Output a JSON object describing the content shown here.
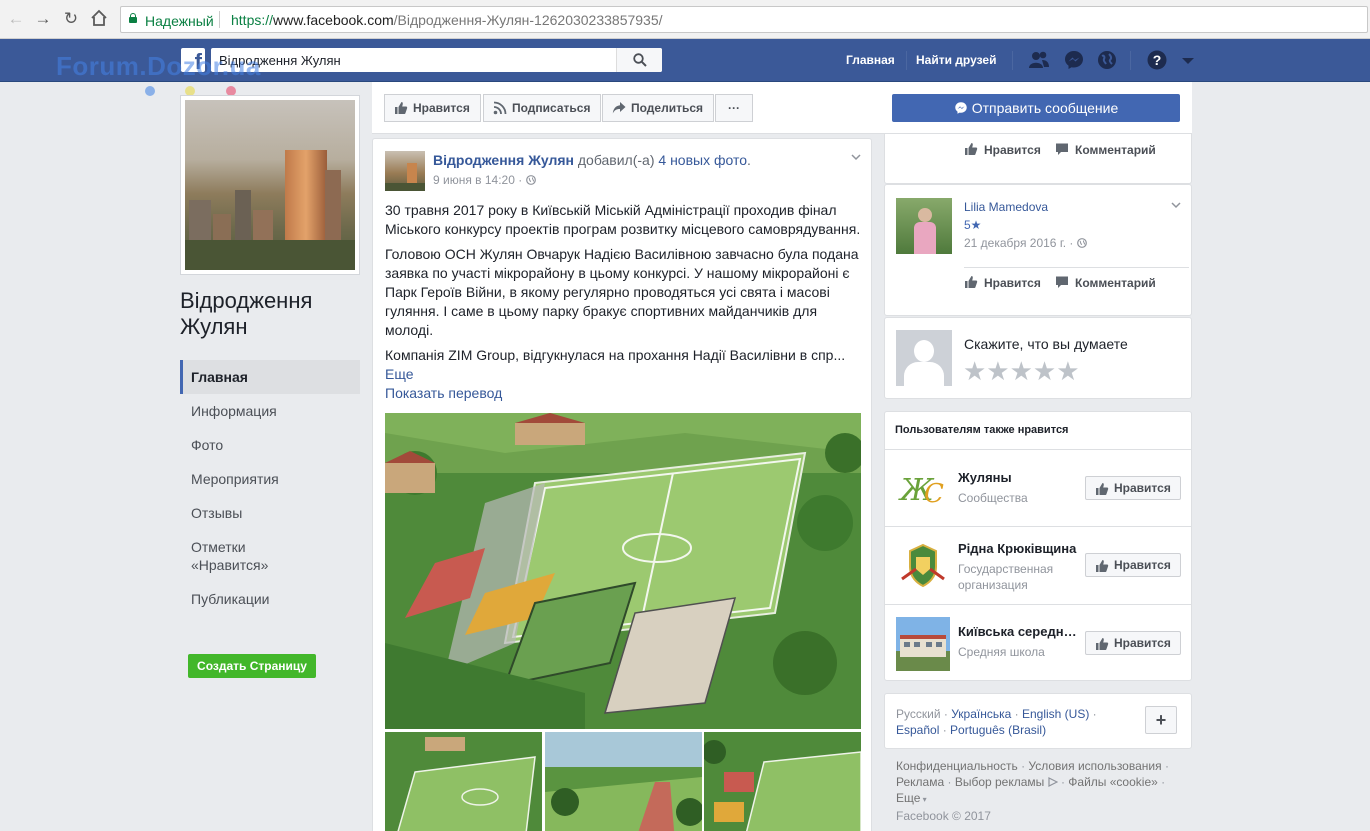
{
  "browser": {
    "secure_label": "Надежный",
    "url_scheme": "https://",
    "url_host": "www.facebook.com",
    "url_path": "/Відродження-Жулян-1262030233857935/"
  },
  "watermark": "Forum.Dozor.ua",
  "topbar": {
    "search_value": "Відродження Жулян",
    "home_label": "Главная",
    "find_friends_label": "Найти друзей",
    "brand_color": "#3b5998"
  },
  "page": {
    "name": "Відродження Жулян",
    "nav": [
      {
        "label": "Главная",
        "active": true
      },
      {
        "label": "Информация"
      },
      {
        "label": "Фото"
      },
      {
        "label": "Мероприятия"
      },
      {
        "label": "Отзывы"
      },
      {
        "label": "Отметки «Нравится»"
      },
      {
        "label": "Публикации"
      }
    ],
    "create_page_label": "Создать Страницу"
  },
  "actions": {
    "like_label": "Нравится",
    "follow_label": "Подписаться",
    "share_label": "Поделиться",
    "more_label": "···",
    "message_label": "Отправить сообщение"
  },
  "post": {
    "author": "Відродження Жулян",
    "added_text": "добавил(-а)",
    "photos_link": "4 новых фото",
    "time": "9 июня в 14:20 ·",
    "paragraph1": "30 травня 2017 року в Київській Міській Адміністрації проходив фінал Міського конкурсу проектів програм розвитку місцевого самоврядування.",
    "paragraph2": "Головою ОСН Жулян Овчарук Надією Василівною завчасно була подана заявка по участі мікрорайону в цьому конкурсі. У нашому мікрорайоні є Парк Героїв Війни, в якому регулярно проводяться усі свята і масові гуляння. І саме в цьому парку бракує спортивних майданчиків для молоді.",
    "paragraph3": "Компанія ZIM Group, відгукнулася на прохання Надії Василівни в спр...",
    "more_link": "Еще",
    "translate_link": "Показать перевод"
  },
  "reviews": {
    "like_label": "Нравится",
    "comment_label": "Комментарий",
    "review": {
      "name": "Lilia Mamedova",
      "rating": "5★",
      "date": "21 декабря 2016 г. ·"
    },
    "prompt": "Скажите, что вы думаете",
    "stars": "★★★★★"
  },
  "also_likes": {
    "title": "Пользователям также нравится",
    "like_label": "Нравится",
    "items": [
      {
        "name": "Жуляны",
        "category": "Сообщества"
      },
      {
        "name": "Рідна Крюківщина",
        "category": "Государственная организация"
      },
      {
        "name": "Київська середня школа",
        "category": "Средняя школа"
      }
    ]
  },
  "languages": {
    "current": "Русский",
    "others": [
      "Українська",
      "English (US)",
      "Español",
      "Português (Brasil)"
    ],
    "plus": "+"
  },
  "footer": {
    "links": [
      "Конфиденциальность",
      "Условия использования",
      "Реклама",
      "Выбор рекламы",
      "Файлы «cookie»",
      "Еще"
    ],
    "copyright": "Facebook © 2017"
  }
}
